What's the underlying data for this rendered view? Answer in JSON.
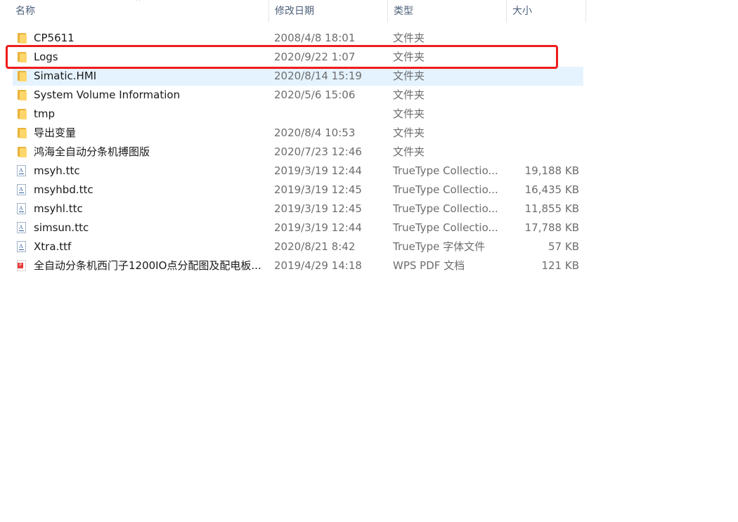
{
  "columns": {
    "name": "名称",
    "date": "修改日期",
    "type": "类型",
    "size": "大小"
  },
  "sort_indicator": "^",
  "files": [
    {
      "name": "CP5611",
      "date": "2008/4/8 18:01",
      "type": "文件夹",
      "size": "",
      "icon": "folder-icon"
    },
    {
      "name": "Logs",
      "date": "2020/9/22 1:07",
      "type": "文件夹",
      "size": "",
      "icon": "folder-icon"
    },
    {
      "name": "Simatic.HMI",
      "date": "2020/8/14 15:19",
      "type": "文件夹",
      "size": "",
      "icon": "folder-icon"
    },
    {
      "name": "System Volume Information",
      "date": "2020/5/6 15:06",
      "type": "文件夹",
      "size": "",
      "icon": "folder-icon"
    },
    {
      "name": "tmp",
      "date": "",
      "type": "文件夹",
      "size": "",
      "icon": "folder-icon"
    },
    {
      "name": "导出变量",
      "date": "2020/8/4 10:53",
      "type": "文件夹",
      "size": "",
      "icon": "folder-icon"
    },
    {
      "name": "鸿海全自动分条机搏图版",
      "date": "2020/7/23 12:46",
      "type": "文件夹",
      "size": "",
      "icon": "folder-icon"
    },
    {
      "name": "msyh.ttc",
      "date": "2019/3/19 12:44",
      "type": "TrueType Collectio...",
      "size": "19,188 KB",
      "icon": "font-file-icon"
    },
    {
      "name": "msyhbd.ttc",
      "date": "2019/3/19 12:45",
      "type": "TrueType Collectio...",
      "size": "16,435 KB",
      "icon": "font-file-icon"
    },
    {
      "name": "msyhl.ttc",
      "date": "2019/3/19 12:45",
      "type": "TrueType Collectio...",
      "size": "11,855 KB",
      "icon": "font-file-icon"
    },
    {
      "name": "simsun.ttc",
      "date": "2019/3/19 12:44",
      "type": "TrueType Collectio...",
      "size": "17,788 KB",
      "icon": "font-file-icon"
    },
    {
      "name": "Xtra.ttf",
      "date": "2020/8/21 8:42",
      "type": "TrueType 字体文件",
      "size": "57 KB",
      "icon": "font-file-icon"
    },
    {
      "name": "全自动分条机西门子1200IO点分配图及配电板...",
      "date": "2019/4/29 14:18",
      "type": "WPS PDF 文档",
      "size": "121 KB",
      "icon": "pdf-file-icon"
    }
  ],
  "hovered_row": 2,
  "highlighted_row": 1,
  "colors": {
    "highlight_border": "#ef1c1c",
    "hover_background": "#e5f3ff",
    "folder": "#ffd66b"
  }
}
